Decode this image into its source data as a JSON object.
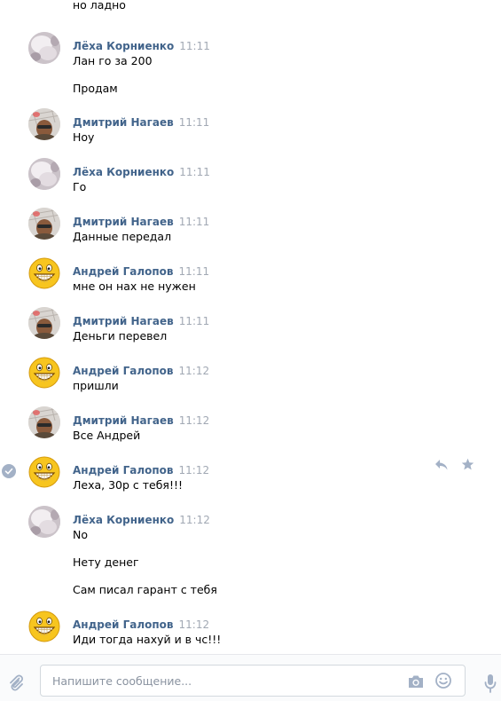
{
  "top_fragment": "но ладно",
  "messages": [
    {
      "sender": "Лёха Корниенко",
      "avatar": "lexa",
      "time": "11:11",
      "lines": [
        "Лан го за 200",
        "Продам"
      ]
    },
    {
      "sender": "Дмитрий Нагаев",
      "avatar": "dmitry",
      "time": "11:11",
      "lines": [
        "Ноу"
      ]
    },
    {
      "sender": "Лёха Корниенко",
      "avatar": "lexa",
      "time": "11:11",
      "lines": [
        "Го"
      ]
    },
    {
      "sender": "Дмитрий Нагаев",
      "avatar": "dmitry",
      "time": "11:11",
      "lines": [
        "Данные передал"
      ]
    },
    {
      "sender": "Андрей Галопов",
      "avatar": "andrey",
      "time": "11:11",
      "lines": [
        "мне он нах не нужен"
      ]
    },
    {
      "sender": "Дмитрий Нагаев",
      "avatar": "dmitry",
      "time": "11:11",
      "lines": [
        "Деньги перевел"
      ]
    },
    {
      "sender": "Андрей Галопов",
      "avatar": "andrey",
      "time": "11:12",
      "lines": [
        "пришли"
      ]
    },
    {
      "sender": "Дмитрий Нагаев",
      "avatar": "dmitry",
      "time": "11:12",
      "lines": [
        "Все Андрей"
      ]
    },
    {
      "sender": "Андрей Галопов",
      "avatar": "andrey",
      "time": "11:12",
      "lines": [
        "Леха, 30р с тебя!!!"
      ],
      "selected": true
    },
    {
      "sender": "Лёха Корниенко",
      "avatar": "lexa",
      "time": "11:12",
      "lines": [
        "No",
        "Нету денег",
        "Сам писал гарант с тебя"
      ]
    },
    {
      "sender": "Андрей Галопов",
      "avatar": "andrey",
      "time": "11:12",
      "lines": [
        "Иди тогда нахуй и в чс!!!"
      ]
    }
  ],
  "composer": {
    "placeholder": "Напишите сообщение..."
  },
  "icons": {
    "attach": "paperclip-icon",
    "camera": "camera-icon",
    "emoji": "smile-icon",
    "mic": "microphone-icon",
    "reply": "reply-icon",
    "favorite": "star-icon",
    "selected": "check-icon"
  },
  "colors": {
    "name": "#42648b",
    "time": "#a2a9b4",
    "icon": "#a3b1c6"
  }
}
